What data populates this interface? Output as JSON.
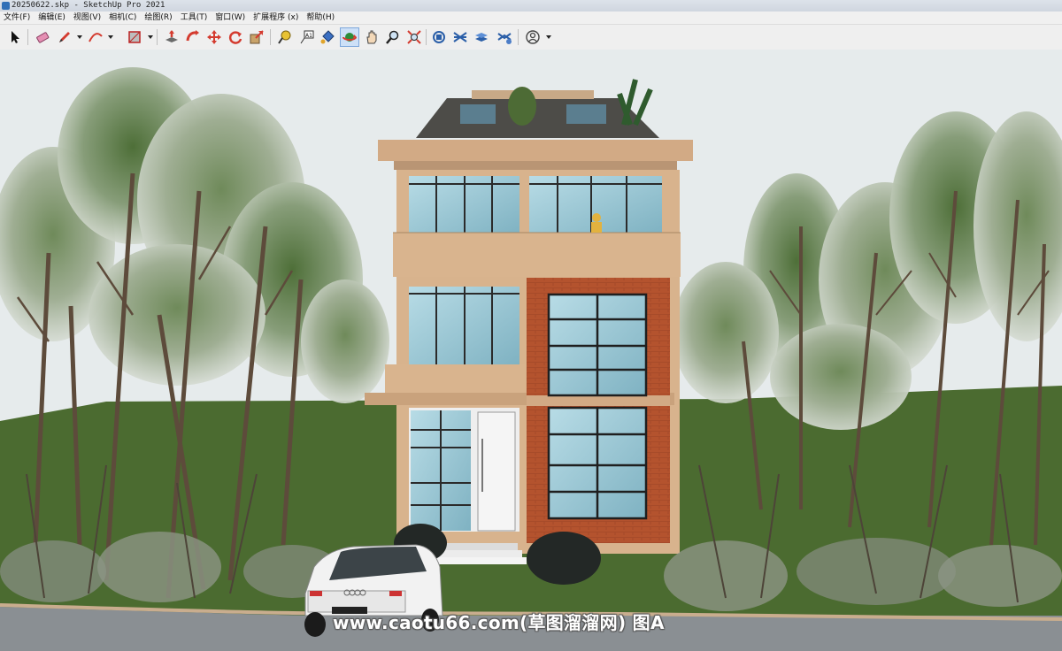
{
  "window": {
    "title": "20250622.skp - SketchUp Pro 2021"
  },
  "menu": [
    {
      "label": "文件(F)"
    },
    {
      "label": "编辑(E)"
    },
    {
      "label": "视图(V)"
    },
    {
      "label": "相机(C)"
    },
    {
      "label": "绘图(R)"
    },
    {
      "label": "工具(T)"
    },
    {
      "label": "窗口(W)"
    },
    {
      "label": "扩展程序 (x)"
    },
    {
      "label": "帮助(H)"
    }
  ],
  "toolbar": {
    "tools": [
      "select-icon",
      "eraser-icon",
      "pencil-line-icon",
      "arc-icon",
      "rectangle-icon",
      "push-pull-icon",
      "follow-me-icon",
      "move-icon",
      "rotate-icon",
      "scale-icon",
      "tape-measure-icon",
      "text-icon",
      "paint-bucket-icon",
      "orbit-icon",
      "pan-icon",
      "zoom-icon",
      "zoom-extents-icon",
      "warehouse-icon",
      "extension-warehouse-icon",
      "layout-icon",
      "extension-manager-icon",
      "account-icon"
    ],
    "text_tool_label": "A1",
    "active_tool": "orbit-icon"
  },
  "viewport": {
    "watermark": "www.caotu66.com(草图溜溜网) 图A",
    "sky_color": "#e6ebec",
    "grass_color": "#4b6b30",
    "road_color": "#8a8f93"
  }
}
